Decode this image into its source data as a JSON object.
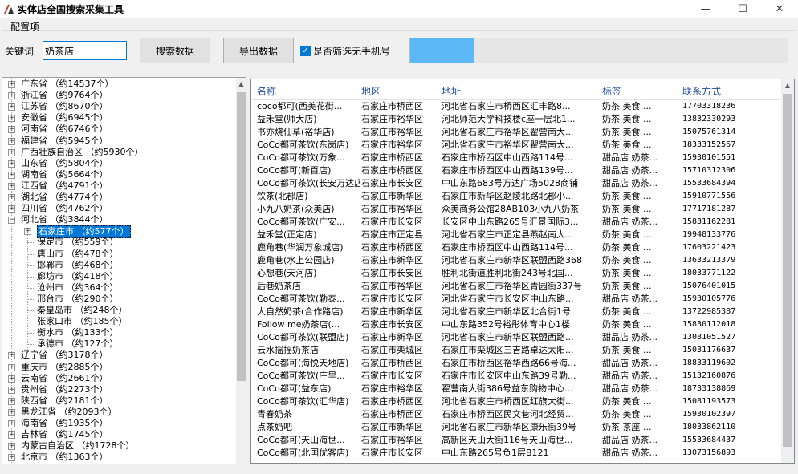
{
  "window": {
    "title": "实体店全国搜索采集工具",
    "minimize": "—",
    "maximize": "☐",
    "close": "✕"
  },
  "config": {
    "group_label": "配置项",
    "keyword_label": "关键词",
    "keyword_value": "奶茶店",
    "search_button": "搜索数据",
    "export_button": "导出数据",
    "filter_checkbox_label": "是否筛选无手机号",
    "filter_checked": true,
    "progress_fraction": 0.17
  },
  "colors": {
    "selection": "#0078d7",
    "progress": "#5cb8f7",
    "header_text": "#1e4e9a"
  },
  "tree": {
    "provinces_top": [
      "广东省 （约14537个）",
      "浙江省 （约9764个）",
      "江苏省 （约8670个）",
      "安徽省 （约6945个）",
      "河南省 （约6746个）",
      "福建省 （约5945个）",
      "广西壮族自治区 （约5930个）",
      "山东省 （约5804个）",
      "湖南省 （约5664个）",
      "江西省 （约4791个）",
      "湖北省 （约4774个）",
      "四川省 （约4762个）"
    ],
    "expanded_province": "河北省 （约3844个）",
    "selected_city": "石家庄市 （约577个）",
    "cities": [
      "保定市 （约559个）",
      "唐山市 （约478个）",
      "邯郸市 （约468个）",
      "廊坊市 （约418个）",
      "沧州市 （约364个）",
      "邢台市 （约290个）",
      "秦皇岛市 （约248个）",
      "张家口市 （约185个）",
      "衡水市 （约133个）",
      "承德市 （约127个）"
    ],
    "provinces_bottom": [
      "辽宁省 （约3178个）",
      "重庆市 （约2885个）",
      "云南省 （约2661个）",
      "贵州省 （约2273个）",
      "陕西省 （约2181个）",
      "黑龙江省 （约2093个）",
      "海南省 （约1935个）",
      "吉林省 （约1745个）",
      "内蒙古自治区 （约1728个）",
      "北京市 （约1363个）"
    ]
  },
  "list": {
    "columns": [
      "名称",
      "地区",
      "地址",
      "标签",
      "联系方式"
    ],
    "rows": [
      [
        "coco都可(西美花街...",
        "石家庄市桥西区",
        "河北省石家庄市桥西区汇丰路8...",
        "奶茶 美食 ...",
        "17703318236"
      ],
      [
        "益禾堂(师大店)",
        "石家庄市裕华区",
        "河北师范大学科技楼c座一层北1...",
        "奶茶 美食 ...",
        "13832330293"
      ],
      [
        "书亦烧仙草(裕华店)",
        "石家庄市裕华区",
        "河北省石家庄市裕华区翟营南大...",
        "奶茶 美食 ...",
        "15075761314"
      ],
      [
        "CoCo都可茶饮(东岗店)",
        "石家庄市裕华区",
        "河北省石家庄市裕华区翟营南大...",
        "奶茶 美食 ...",
        "18333152567"
      ],
      [
        "CoCo都可茶饮(万象...",
        "石家庄市桥西区",
        "石家庄市桥西区中山西路114号...",
        "甜品店 奶茶...",
        "15930101551"
      ],
      [
        "CoCo都可(新百店)",
        "石家庄市桥西区",
        "石家庄市桥西区中山西路139号...",
        "甜品店 奶茶...",
        "15710312306"
      ],
      [
        "CoCo都可茶饮(长安万达店)",
        "石家庄市长安区",
        "中山东路683号万达广场5028商铺",
        "甜品店 奶茶...",
        "15533684394"
      ],
      [
        "饮茶(北郡店)",
        "石家庄市新华区",
        "石家庄市新华区赵陵北路北郡小...",
        "奶茶 美食 ...",
        "15910771556"
      ],
      [
        "小九八奶茶(众美店)",
        "石家庄市裕华区",
        "众美商务公馆28AB103小九八奶茶",
        "奶茶 美食 ...",
        "17717181287"
      ],
      [
        "CoCo都可茶饮(广安...",
        "石家庄市长安区",
        "长安区中山东路265号汇景国际3...",
        "甜品店 奶茶...",
        "15831162281"
      ],
      [
        "益禾堂(正定店)",
        "石家庄市正定县",
        "河北省石家庄市正定县燕赵南大...",
        "奶茶 美食 ...",
        "19948133776"
      ],
      [
        "鹿角巷(华润万象城店)",
        "石家庄市桥西区",
        "石家庄市桥西区中山西路114号...",
        "奶茶 美食 ...",
        "17603221423"
      ],
      [
        "鹿角巷(水上公园店)",
        "石家庄市新华区",
        "河北省石家庄市新华区联盟西路368",
        "奶茶 美食 ...",
        "13633213379"
      ],
      [
        "心想巷(天河店)",
        "石家庄市长安区",
        "胜利北街道胜利北街243号北国...",
        "奶茶 美食 ...",
        "18033771122"
      ],
      [
        "后巷奶茶店",
        "石家庄市裕华区",
        "河北省石家庄市裕华区青园街337号",
        "奶茶 美食 ...",
        "15076401015"
      ],
      [
        "CoCo都可茶饮(勒泰...",
        "石家庄市长安区",
        "河北省石家庄市长安区中山东路...",
        "甜品店 奶茶...",
        "15930105776"
      ],
      [
        "大自然奶茶(合作路店)",
        "石家庄市新华区",
        "河北省石家庄市新华区北合街1号",
        "奶茶 美食 ...",
        "13722985387"
      ],
      [
        "Follow me奶茶店(...",
        "石家庄市长安区",
        "中山东路352号裕彤体育中心1楼",
        "奶茶 美食 ...",
        "15830112018"
      ],
      [
        "CoCo都可茶饮(联盟店)",
        "石家庄市新华区",
        "河北省石家庄市新华区联盟西路...",
        "甜品店 奶茶...",
        "13081051527"
      ],
      [
        "云水摇摇奶茶店",
        "石家庄市栾城区",
        "石家庄市栾城区三吉路卓达太阳...",
        "奶茶 美食 ...",
        "15031176637"
      ],
      [
        "CoCo都可(海悦天地店)",
        "石家庄市桥西区",
        "石家庄市桥西区裕华西路66号海...",
        "甜品店 奶茶...",
        "18833119602"
      ],
      [
        "CoCo都可茶饮(庄里...",
        "石家庄市长安区",
        "石家庄市长安区中山东路39号勒...",
        "甜品店 奶茶...",
        "15132160876"
      ],
      [
        "CoCo都可(益东店)",
        "石家庄市裕华区",
        "翟营南大街386号益东购物中心...",
        "甜品店 奶茶...",
        "18733138869"
      ],
      [
        "CoCo都可茶饮(汇华店)",
        "石家庄市桥西区",
        "河北省石家庄市桥西区红旗大街...",
        "奶茶 美食 ...",
        "15081193573"
      ],
      [
        "青春奶茶",
        "石家庄市桥西区",
        "石家庄市桥西区民文巷河北经贸...",
        "奶茶 美食 ...",
        "15930102397"
      ],
      [
        "点茶奶吧",
        "石家庄市新华区",
        "河北省石家庄市新华区康乐街39号",
        "奶茶 茶座 ...",
        "18033862110"
      ],
      [
        "CoCo都可(天山海世...",
        "石家庄市裕华区",
        "高新区天山大街116号天山海世...",
        "甜品店 奶茶...",
        "15533684437"
      ],
      [
        "CoCo都可(北国优客店)",
        "石家庄市长安区",
        "中山东路265号负1层B121",
        "甜品店 奶茶...",
        "13073156893"
      ]
    ]
  }
}
